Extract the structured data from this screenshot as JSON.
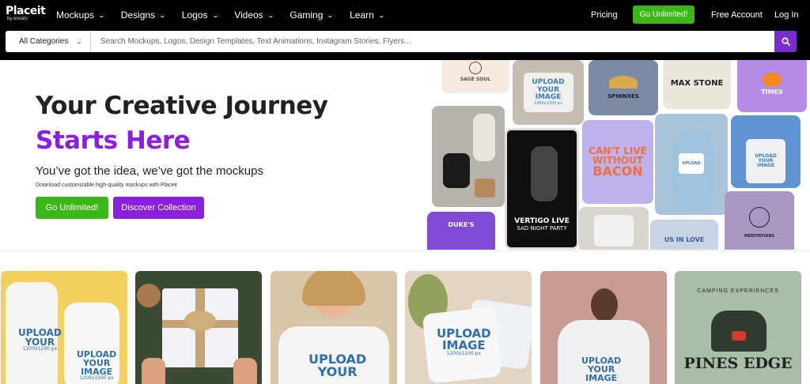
{
  "nav": {
    "logo_top": "Placeit",
    "logo_bottom": "by envato",
    "menu": [
      "Mockups",
      "Designs",
      "Logos",
      "Videos",
      "Gaming",
      "Learn"
    ],
    "pricing": "Pricing",
    "go_unlimited": "Go Unlimited!",
    "free_account": "Free Account",
    "login": "Log In"
  },
  "search": {
    "category": "All Categories",
    "placeholder": "Search Mockups, Logos, Design Templates, Text Animations, Instagram Stories, Flyers..."
  },
  "hero": {
    "title_line1": "Your Creative Journey",
    "title_line2": "Starts Here",
    "subtitle": "You’ve got the idea, we’ve got the mockups",
    "small": "Download customizable high-quality mockups with Placeit",
    "btn_unlimited": "Go Unlimited!",
    "btn_discover": "Discover Collection"
  },
  "mosaic": {
    "sage_soul": "SAGE SOUL",
    "upload": "UPLOAD",
    "your": "YOUR",
    "image": "IMAGE",
    "size": "1200x1200 px",
    "sphinxes": "SPHINXES",
    "max_stone": "MAX STONE",
    "times": "TIMES",
    "cant_live": "CAN'T LIVE",
    "without": "WITHOUT",
    "bacon": "BACON",
    "vertigo": "VERTIGO LIVE",
    "sad_night": "SAD NIGHT PARTY",
    "dukes": "DUKE'S",
    "meditations": "MEDITATIONS",
    "us_in_love": "US IN LOVE"
  },
  "products": {
    "upload": "UPLOAD",
    "your": "YOUR",
    "image": "IMAGE",
    "size": "1200x1200 px",
    "camping": "CAMPING EXPERIENCES",
    "pines": "PINES EDGE"
  },
  "colors": {
    "accent_purple": "#8a1fe0",
    "accent_green": "#3bb818",
    "nav_bg": "#000000"
  }
}
